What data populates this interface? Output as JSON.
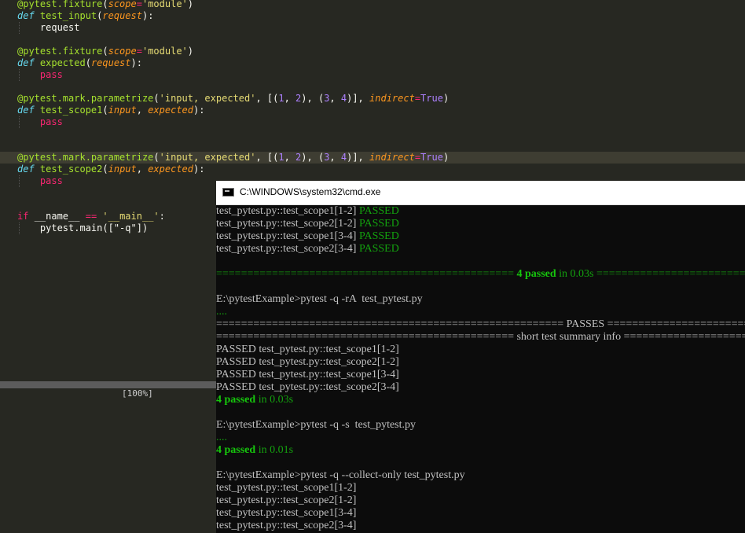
{
  "editor": {
    "lines": [
      {
        "tokens": [
          [
            "dec",
            "@pytest."
          ],
          [
            "fn",
            "fixture"
          ],
          [
            "",
            "("
          ],
          [
            "par",
            "scope"
          ],
          [
            "op",
            "="
          ],
          [
            "str",
            "'module'"
          ],
          [
            "",
            ")"
          ]
        ]
      },
      {
        "tokens": [
          [
            "kw",
            "def "
          ],
          [
            "fn",
            "test_input"
          ],
          [
            "",
            "("
          ],
          [
            "par",
            "request"
          ],
          [
            "",
            "):"
          ]
        ]
      },
      {
        "tokens": [
          [
            "",
            "    request"
          ]
        ]
      },
      {
        "tokens": []
      },
      {
        "tokens": [
          [
            "dec",
            "@pytest."
          ],
          [
            "fn",
            "fixture"
          ],
          [
            "",
            "("
          ],
          [
            "par",
            "scope"
          ],
          [
            "op",
            "="
          ],
          [
            "str",
            "'module'"
          ],
          [
            "",
            ")"
          ]
        ]
      },
      {
        "tokens": [
          [
            "kw",
            "def "
          ],
          [
            "fn",
            "expected"
          ],
          [
            "",
            "("
          ],
          [
            "par",
            "request"
          ],
          [
            "",
            "):"
          ]
        ]
      },
      {
        "tokens": [
          [
            "pass",
            "    pass"
          ]
        ]
      },
      {
        "tokens": []
      },
      {
        "tokens": [
          [
            "dec",
            "@pytest."
          ],
          [
            "fn",
            "mark.parametrize"
          ],
          [
            "",
            "("
          ],
          [
            "str",
            "'input, expected'"
          ],
          [
            "",
            ", [("
          ],
          [
            "num",
            "1"
          ],
          [
            "",
            ", "
          ],
          [
            "num",
            "2"
          ],
          [
            "",
            "), ("
          ],
          [
            "num",
            "3"
          ],
          [
            "",
            ", "
          ],
          [
            "num",
            "4"
          ],
          [
            "",
            ")], "
          ],
          [
            "par",
            "indirect"
          ],
          [
            "op",
            "="
          ],
          [
            "true",
            "True"
          ],
          [
            "",
            ")"
          ]
        ]
      },
      {
        "tokens": [
          [
            "kw",
            "def "
          ],
          [
            "fn",
            "test_scope1"
          ],
          [
            "",
            "("
          ],
          [
            "par",
            "input"
          ],
          [
            "",
            ", "
          ],
          [
            "par",
            "expected"
          ],
          [
            "",
            "):"
          ]
        ]
      },
      {
        "tokens": [
          [
            "pass",
            "    pass"
          ]
        ]
      },
      {
        "tokens": []
      },
      {
        "tokens": []
      },
      {
        "tokens": [
          [
            "dec",
            "@pytest."
          ],
          [
            "fn",
            "mark.parametrize"
          ],
          [
            "",
            "("
          ],
          [
            "str",
            "'input, expected'"
          ],
          [
            "",
            ", [("
          ],
          [
            "num",
            "1"
          ],
          [
            "",
            ", "
          ],
          [
            "num",
            "2"
          ],
          [
            "",
            "), ("
          ],
          [
            "num",
            "3"
          ],
          [
            "",
            ", "
          ],
          [
            "num",
            "4"
          ],
          [
            "",
            ")], "
          ],
          [
            "par",
            "indirect"
          ],
          [
            "op",
            "="
          ],
          [
            "true",
            "True"
          ],
          [
            "",
            ")"
          ]
        ],
        "current": true
      },
      {
        "tokens": [
          [
            "kw",
            "def "
          ],
          [
            "fn",
            "test_scope2"
          ],
          [
            "",
            "("
          ],
          [
            "par",
            "input"
          ],
          [
            "",
            ", "
          ],
          [
            "par",
            "expected"
          ],
          [
            "",
            "):"
          ]
        ]
      },
      {
        "tokens": [
          [
            "pass",
            "    pass"
          ]
        ]
      },
      {
        "tokens": []
      },
      {
        "tokens": []
      },
      {
        "tokens": [
          [
            "kw2",
            "if "
          ],
          [
            "",
            "__name__ "
          ],
          [
            "op",
            "=="
          ],
          [
            "str",
            " '__main__'"
          ],
          [
            "",
            ":"
          ]
        ]
      },
      {
        "tokens": [
          [
            "",
            "    pytest.main([\"-q\"])"
          ]
        ]
      }
    ],
    "zoom": "[100%]"
  },
  "cmd": {
    "title": "C:\\WINDOWS\\system32\\cmd.exe",
    "lines": [
      {
        "segs": [
          [
            "",
            "test_pytest.py::test_scope1[1-2] "
          ],
          [
            "green",
            "PASSED"
          ]
        ]
      },
      {
        "segs": [
          [
            "",
            "test_pytest.py::test_scope2[1-2] "
          ],
          [
            "green",
            "PASSED"
          ]
        ]
      },
      {
        "segs": [
          [
            "",
            "test_pytest.py::test_scope1[3-4] "
          ],
          [
            "green",
            "PASSED"
          ]
        ]
      },
      {
        "segs": [
          [
            "",
            "test_pytest.py::test_scope2[3-4] "
          ],
          [
            "green",
            "PASSED"
          ]
        ]
      },
      {
        "segs": []
      },
      {
        "segs": [
          [
            "green",
            "================================================ "
          ],
          [
            "bgreen",
            "4 passed"
          ],
          [
            "green",
            " in 0.03s ================================="
          ]
        ]
      },
      {
        "segs": []
      },
      {
        "segs": [
          [
            "",
            "E:\\pytestExample>pytest -q -rA  test_pytest.py"
          ]
        ]
      },
      {
        "segs": [
          [
            "green",
            "...."
          ]
        ]
      },
      {
        "segs": [
          [
            "",
            "======================================================== PASSES ========================================"
          ]
        ]
      },
      {
        "segs": [
          [
            "",
            "================================================ short test summary info ==================================="
          ]
        ]
      },
      {
        "segs": [
          [
            "",
            "PASSED test_pytest.py::test_scope1[1-2]"
          ]
        ]
      },
      {
        "segs": [
          [
            "",
            "PASSED test_pytest.py::test_scope2[1-2]"
          ]
        ]
      },
      {
        "segs": [
          [
            "",
            "PASSED test_pytest.py::test_scope1[3-4]"
          ]
        ]
      },
      {
        "segs": [
          [
            "",
            "PASSED test_pytest.py::test_scope2[3-4]"
          ]
        ]
      },
      {
        "segs": [
          [
            "bgreen",
            "4 passed"
          ],
          [
            "green",
            " in 0.03s"
          ]
        ]
      },
      {
        "segs": []
      },
      {
        "segs": [
          [
            "",
            "E:\\pytestExample>pytest -q -s  test_pytest.py"
          ]
        ]
      },
      {
        "segs": [
          [
            "green",
            "...."
          ]
        ]
      },
      {
        "segs": [
          [
            "bgreen",
            "4 passed"
          ],
          [
            "green",
            " in 0.01s"
          ]
        ]
      },
      {
        "segs": []
      },
      {
        "segs": [
          [
            "",
            "E:\\pytestExample>pytest -q --collect-only test_pytest.py"
          ]
        ]
      },
      {
        "segs": [
          [
            "",
            "test_pytest.py::test_scope1[1-2]"
          ]
        ]
      },
      {
        "segs": [
          [
            "",
            "test_pytest.py::test_scope2[1-2]"
          ]
        ]
      },
      {
        "segs": [
          [
            "",
            "test_pytest.py::test_scope1[3-4]"
          ]
        ]
      },
      {
        "segs": [
          [
            "",
            "test_pytest.py::test_scope2[3-4]"
          ]
        ]
      }
    ]
  }
}
